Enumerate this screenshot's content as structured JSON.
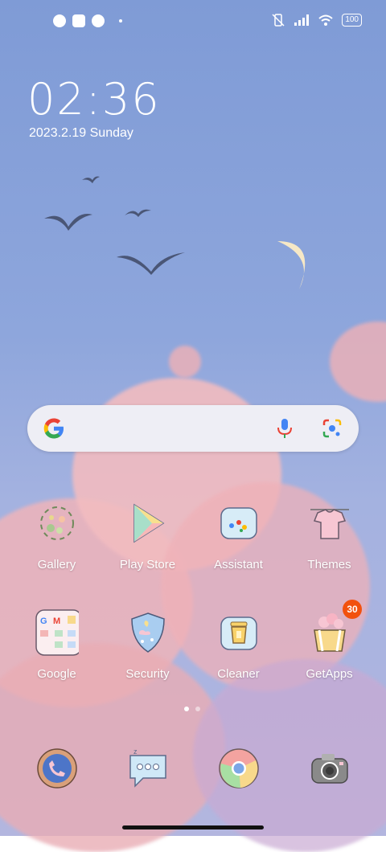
{
  "status_bar": {
    "battery": "100"
  },
  "clock": {
    "time": "02:36",
    "date": "2023.2.19 Sunday"
  },
  "search_bar": {
    "google_letter": "G"
  },
  "apps_row1": [
    {
      "label": "Gallery",
      "icon": "gallery-icon"
    },
    {
      "label": "Play Store",
      "icon": "play-store-icon"
    },
    {
      "label": "Assistant",
      "icon": "assistant-icon"
    },
    {
      "label": "Themes",
      "icon": "themes-icon"
    }
  ],
  "apps_row2": [
    {
      "label": "Google",
      "icon": "google-folder-icon"
    },
    {
      "label": "Security",
      "icon": "security-icon"
    },
    {
      "label": "Cleaner",
      "icon": "cleaner-icon"
    },
    {
      "label": "GetApps",
      "icon": "getapps-icon",
      "badge": "30"
    }
  ],
  "dock": [
    {
      "icon": "phone-icon"
    },
    {
      "icon": "messages-icon"
    },
    {
      "icon": "chrome-icon"
    },
    {
      "icon": "camera-icon"
    }
  ],
  "pager": {
    "pages": 2,
    "active": 0
  },
  "colors": {
    "sky": "#8ea6dc",
    "cloud": "#f0b3b8",
    "badge": "#f2510e"
  }
}
